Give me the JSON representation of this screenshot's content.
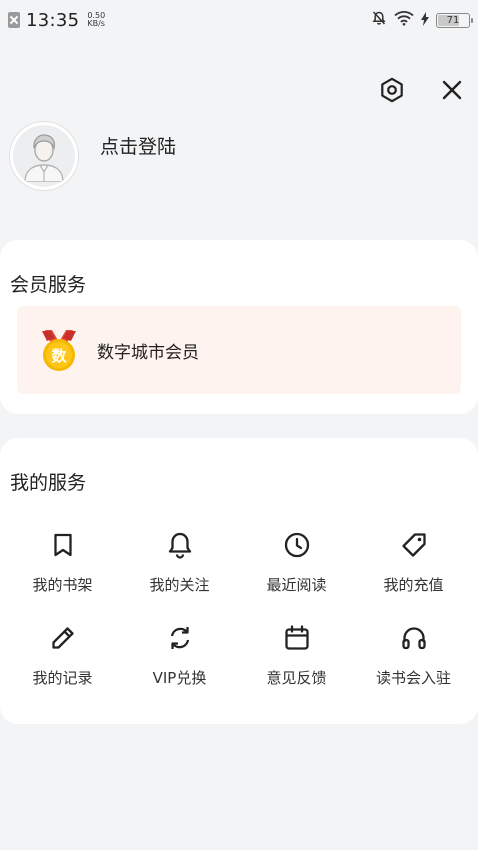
{
  "status_bar": {
    "time": "13:35",
    "speed_value": "0.50",
    "speed_unit": "KB/s",
    "battery": "71",
    "battery_level": 0.71,
    "icons": [
      "notification-off-icon",
      "wifi-icon",
      "charging-icon",
      "battery-icon"
    ]
  },
  "header": {
    "actions": [
      "settings-icon",
      "close-icon"
    ]
  },
  "profile": {
    "login_text": "点击登陆",
    "avatar_icon": "user-avatar-icon"
  },
  "vip": {
    "title": "会员服务",
    "banner_label": "数字城市会员",
    "badge_text": "数",
    "badge_color": "#f5b800",
    "banner_bg": "#fff3f0"
  },
  "services": {
    "title": "我的服务",
    "items": [
      {
        "label": "我的书架",
        "icon": "bookmark-icon"
      },
      {
        "label": "我的关注",
        "icon": "bell-icon"
      },
      {
        "label": "最近阅读",
        "icon": "clock-icon"
      },
      {
        "label": "我的充值",
        "icon": "tag-icon"
      },
      {
        "label": "我的记录",
        "icon": "pencil-icon"
      },
      {
        "label": "VIP兑换",
        "icon": "refresh-icon"
      },
      {
        "label": "意见反馈",
        "icon": "calendar-icon"
      },
      {
        "label": "读书会入驻",
        "icon": "headphones-icon"
      }
    ]
  }
}
